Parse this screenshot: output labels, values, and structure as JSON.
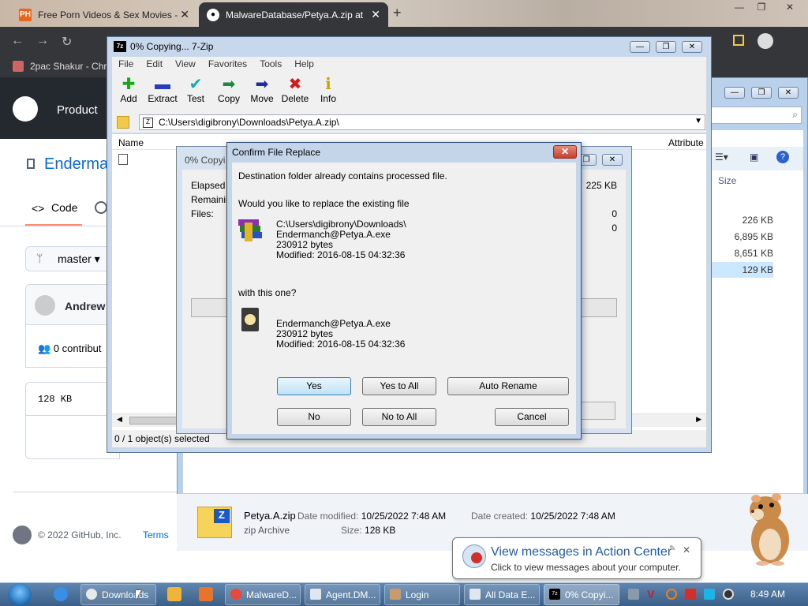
{
  "browser": {
    "tabs": [
      {
        "label": "Free Porn Videos & Sex Movies -",
        "favicon": "PH"
      },
      {
        "label": "MalwareDatabase/Petya.A.zip at"
      }
    ],
    "bookmark": "2pac Shakur - Chro",
    "github": {
      "product": "Product",
      "repo": "Enderma",
      "code_tab": "Code",
      "branch": "master",
      "author": "Andrew",
      "contributors": "0 contribut",
      "size": "128 KB",
      "copyright": "© 2022 GitHub, Inc.",
      "terms": "Terms"
    }
  },
  "explorer": {
    "size_header": "Size",
    "sizes": [
      "226 KB",
      "6,895 KB",
      "8,651 KB",
      "129 KB"
    ],
    "details": {
      "name": "Petya.A.zip",
      "type": "zip Archive",
      "modified_label": "Date modified:",
      "modified": "10/25/2022 7:48 AM",
      "created_label": "Date created:",
      "created": "10/25/2022 7:48 AM",
      "size_label": "Size:",
      "size": "128 KB"
    }
  },
  "sevenzip": {
    "title": "0% Copying... 7-Zip",
    "app_icon": "7z",
    "menu": [
      "File",
      "Edit",
      "View",
      "Favorites",
      "Tools",
      "Help"
    ],
    "toolbar": [
      {
        "label": "Add",
        "icon": "plus-icon",
        "glyph": "✚",
        "color": "#1fa31f"
      },
      {
        "label": "Extract",
        "icon": "minus-icon",
        "glyph": "▬",
        "color": "#2a3bb8"
      },
      {
        "label": "Test",
        "icon": "check-icon",
        "glyph": "✔",
        "color": "#19a6a6"
      },
      {
        "label": "Copy",
        "icon": "arrow-right-icon",
        "glyph": "➡",
        "color": "#1b8a3b"
      },
      {
        "label": "Move",
        "icon": "arrow-right-icon",
        "glyph": "➡",
        "color": "#1b2ca8"
      },
      {
        "label": "Delete",
        "icon": "x-icon",
        "glyph": "✖",
        "color": "#d11a1a"
      },
      {
        "label": "Info",
        "icon": "info-icon",
        "glyph": "ℹ",
        "color": "#c9a400"
      }
    ],
    "path": "C:\\Users\\digibrony\\Downloads\\Petya.A.zip\\",
    "columns": {
      "name": "Name",
      "attributes": "Attribute"
    },
    "status": "0 / 1 object(s) selected"
  },
  "progress": {
    "title": "0% Copyi",
    "labels": [
      "Elapsed ti",
      "Remaining",
      "Files:"
    ],
    "values": [
      "225 KB",
      "0",
      "0"
    ]
  },
  "confirm": {
    "title": "Confirm File Replace",
    "close_glyph": "✕",
    "message": "Destination folder already contains processed file.",
    "question": "Would you like to replace the existing file",
    "existing": {
      "path": "C:\\Users\\digibrony\\Downloads\\",
      "name": "Endermanch@Petya.A.exe",
      "size": "230912 bytes",
      "modified": "Modified: 2016-08-15 04:32:36"
    },
    "with_label": "with this one?",
    "incoming": {
      "name": "Endermanch@Petya.A.exe",
      "size": "230912 bytes",
      "modified": "Modified: 2016-08-15 04:32:36"
    },
    "buttons": {
      "yes": "Yes",
      "yes_all": "Yes to All",
      "auto_rename": "Auto Rename",
      "no": "No",
      "no_all": "No to All",
      "cancel": "Cancel"
    }
  },
  "notification": {
    "title": "View messages in Action Center",
    "subtitle": "Click to view messages about your computer."
  },
  "taskbar": {
    "tasks": [
      "Downloads",
      "MalwareD...",
      "Agent.DM...",
      "Login",
      "All Data E...",
      "0% Copyi..."
    ],
    "clock": "8:49 AM"
  }
}
